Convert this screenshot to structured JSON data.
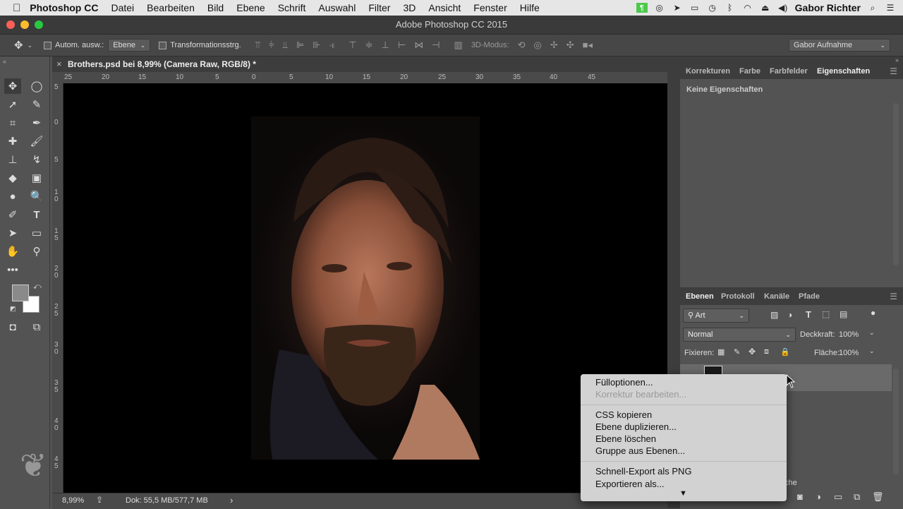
{
  "menubar": {
    "app": "Photoshop CC",
    "items": [
      "Datei",
      "Bearbeiten",
      "Bild",
      "Ebene",
      "Schrift",
      "Auswahl",
      "Filter",
      "3D",
      "Ansicht",
      "Fenster",
      "Hilfe"
    ],
    "user": "Gabor Richter"
  },
  "window": {
    "title": "Adobe Photoshop CC 2015"
  },
  "options": {
    "auto_select_label": "Autom. ausw.:",
    "auto_select_value": "Ebene",
    "transform_label": "Transformationsstrg.",
    "mode_3d_label": "3D-Modus:",
    "workspace": "Gabor Aufnahme"
  },
  "document": {
    "tab_title": "Brothers.psd bei 8,99% (Camera Raw, RGB/8) *",
    "close_glyph": "×",
    "ruler_h": [
      "25",
      "20",
      "15",
      "10",
      "5",
      "0",
      "5",
      "10",
      "15",
      "20",
      "25",
      "30",
      "35",
      "40",
      "45"
    ],
    "ruler_v": [
      "5",
      "0",
      "5",
      "1 0",
      "1 5",
      "2 0",
      "2 5",
      "3 0",
      "3 5",
      "4 0",
      "4 5"
    ]
  },
  "status": {
    "zoom": "8,99%",
    "doc": "Dok: 55,5 MB/577,7 MB",
    "arrow": "›"
  },
  "properties_panel": {
    "tabs": [
      "Korrekturen",
      "Farbe",
      "Farbfelder",
      "Eigenschaften"
    ],
    "active": "Eigenschaften",
    "body": "Keine Eigenschaften"
  },
  "layers_panel": {
    "tabs": [
      "Ebenen",
      "Protokoll",
      "Kanäle",
      "Pfade"
    ],
    "filter_kind": "Art",
    "blend_mode": "Normal",
    "opacity_label": "Deckkraft:",
    "opacity": "100%",
    "lock_label": "Fixieren:",
    "fill_label": "Fläche:",
    "fill": "100%",
    "partial_text": "che"
  },
  "context_menu": {
    "groups": [
      [
        {
          "label": "Fülloptionen...",
          "enabled": true
        },
        {
          "label": "Korrektur bearbeiten...",
          "enabled": false
        }
      ],
      [
        {
          "label": "CSS kopieren",
          "enabled": true
        },
        {
          "label": "Ebene duplizieren...",
          "enabled": true
        },
        {
          "label": "Ebene löschen",
          "enabled": true
        },
        {
          "label": "Gruppe aus Ebenen...",
          "enabled": true
        }
      ],
      [
        {
          "label": "Schnell-Export als PNG",
          "enabled": true
        },
        {
          "label": "Exportieren als...",
          "enabled": true
        }
      ]
    ],
    "more_glyph": "▼"
  },
  "colors": {
    "foreground": "#8a8a8a",
    "background": "#ffffff"
  },
  "icons": [
    "apple-icon",
    "move-icon",
    "marquee-icon",
    "lasso-icon",
    "quick-select-icon",
    "crop-icon",
    "eyedropper-icon",
    "healing-icon",
    "brush-icon",
    "stamp-icon",
    "history-brush-icon",
    "eraser-icon",
    "gradient-icon",
    "blur-icon",
    "dodge-icon",
    "pen-icon",
    "type-icon",
    "path-select-icon",
    "rectangle-icon",
    "hand-icon",
    "zoom-icon",
    "more-tools-icon",
    "search-icon",
    "list-icon",
    "wifi-icon",
    "volume-icon",
    "bluetooth-icon"
  ]
}
